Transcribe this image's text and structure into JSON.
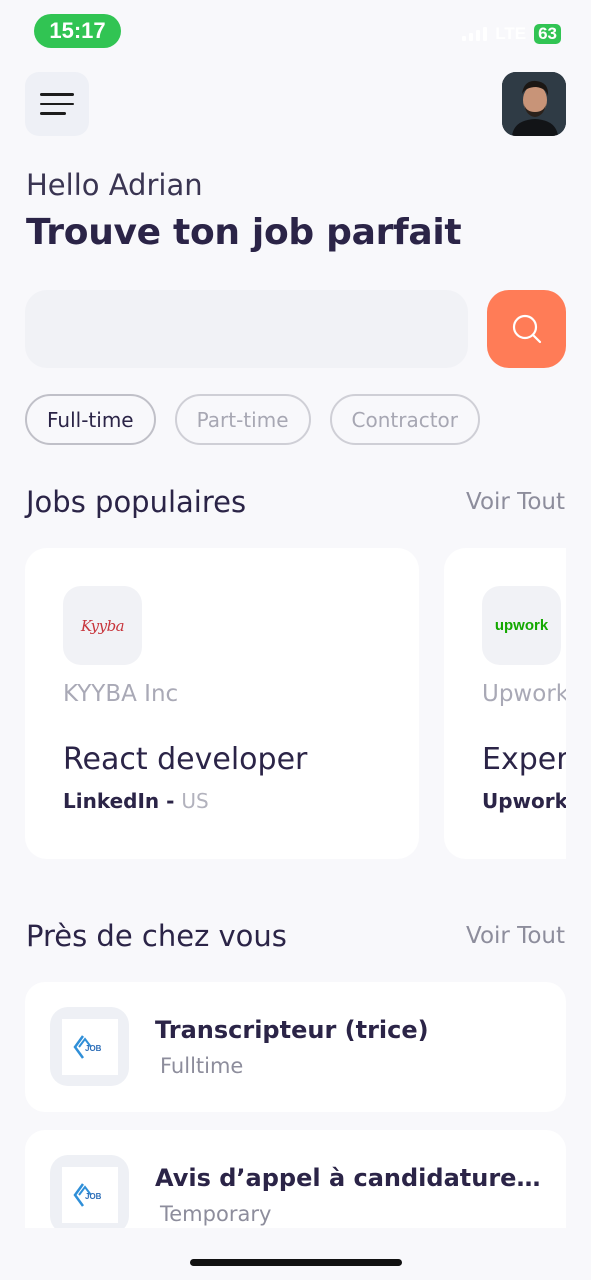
{
  "status_bar": {
    "time": "15:17",
    "network": "LTE",
    "battery": "63"
  },
  "header": {
    "menu_icon": "hamburger-icon",
    "avatar_icon": "profile-photo"
  },
  "greeting": "Hello Adrian",
  "headline": "Trouve ton job parfait",
  "search": {
    "placeholder": "",
    "value": "",
    "icon": "search-icon"
  },
  "filters": [
    {
      "label": "Full-time",
      "active": true
    },
    {
      "label": "Part-time",
      "active": false
    },
    {
      "label": "Contractor",
      "active": false
    }
  ],
  "popular": {
    "title": "Jobs populaires",
    "see_all": "Voir Tout",
    "jobs": [
      {
        "logo": "kyyba-logo",
        "logo_text": "Kyyba",
        "company": "KYYBA Inc",
        "title": "React developer",
        "source": "LinkedIn - ",
        "location": "US"
      },
      {
        "logo": "upwork-logo",
        "logo_text": "upwork",
        "company": "Upwork",
        "title": "Exper",
        "source": "Upwork",
        "location": ""
      }
    ]
  },
  "nearby": {
    "title": "Près de chez vous",
    "see_all": "Voir Tout",
    "jobs": [
      {
        "logo": "job-logo",
        "logo_text": "JOB",
        "title": "Transcripteur (trice)",
        "type": "Fulltime"
      },
      {
        "logo": "job-logo",
        "logo_text": "JOB",
        "title": "Avis d’appel à candidature…",
        "type": "Temporary"
      }
    ]
  },
  "colors": {
    "accent": "#ff7c57",
    "primary_text": "#2b2447",
    "status_green": "#31c453",
    "background": "#f8f8fb"
  }
}
